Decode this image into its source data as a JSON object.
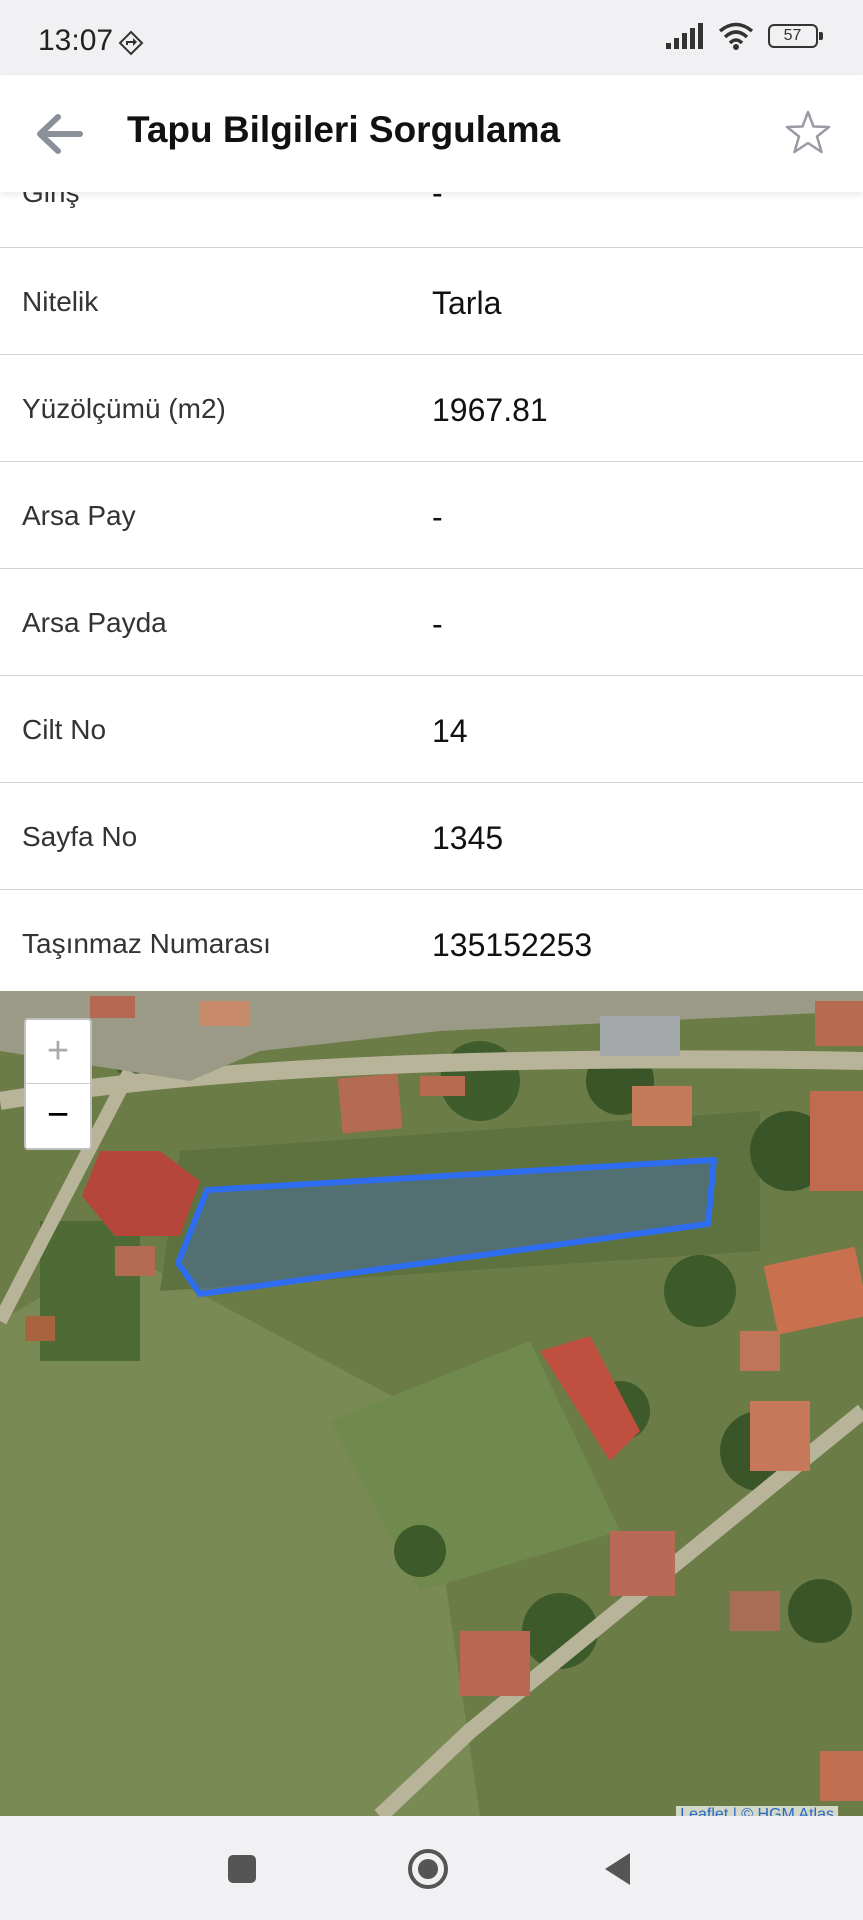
{
  "status_bar": {
    "time": "13:07",
    "battery": "57"
  },
  "app_bar": {
    "title": "Tapu Bilgileri Sorgulama"
  },
  "rows": [
    {
      "label": "Giriş",
      "value": "-"
    },
    {
      "label": "Nitelik",
      "value": "Tarla"
    },
    {
      "label": "Yüzölçümü (m2)",
      "value": "1967.81"
    },
    {
      "label": "Arsa Pay",
      "value": "-"
    },
    {
      "label": "Arsa Payda",
      "value": "-"
    },
    {
      "label": "Cilt No",
      "value": "14"
    },
    {
      "label": "Sayfa No",
      "value": "1345"
    },
    {
      "label": "Taşınmaz Numarası",
      "value": "135152253"
    }
  ],
  "map": {
    "zoom_in": "+",
    "zoom_out": "−",
    "attribution": "Leaflet | © HGM Atlas",
    "parcel_color": "#2f6df0"
  }
}
